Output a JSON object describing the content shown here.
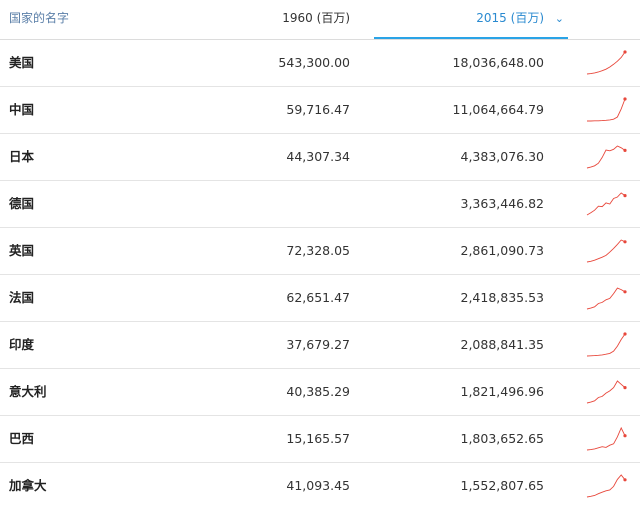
{
  "header": {
    "name_label": "国家的名字",
    "col_1960_label": "1960 (百万)",
    "col_2015_label": "2015 (百万)",
    "sort_icon": "chevron-down-icon",
    "active_color": "#2aa3e6",
    "spark_color": "#e8483c"
  },
  "rows": [
    {
      "name": "美国",
      "v1960": "543,300.00",
      "v2015": "18,036,648.00",
      "spark": [
        0.0,
        0.02,
        0.05,
        0.09,
        0.15,
        0.22,
        0.32,
        0.44,
        0.58,
        0.75,
        1.0
      ]
    },
    {
      "name": "中国",
      "v1960": "59,716.47",
      "v2015": "11,064,664.79",
      "spark": [
        0.0,
        0.0,
        0.01,
        0.01,
        0.02,
        0.03,
        0.05,
        0.08,
        0.18,
        0.55,
        1.0
      ]
    },
    {
      "name": "日本",
      "v1960": "44,307.34",
      "v2015": "4,383,076.30",
      "spark": [
        0.0,
        0.04,
        0.1,
        0.22,
        0.48,
        0.82,
        0.78,
        0.85,
        1.0,
        0.92,
        0.8
      ]
    },
    {
      "name": "德国",
      "v1960": "",
      "v2015": "3,363,446.82",
      "spark": [
        0.0,
        0.1,
        0.22,
        0.4,
        0.38,
        0.55,
        0.5,
        0.75,
        0.82,
        1.0,
        0.88
      ]
    },
    {
      "name": "英国",
      "v1960": "72,328.05",
      "v2015": "2,861,090.73",
      "spark": [
        0.0,
        0.03,
        0.08,
        0.15,
        0.22,
        0.3,
        0.45,
        0.62,
        0.8,
        1.0,
        0.92
      ]
    },
    {
      "name": "法国",
      "v1960": "62,651.47",
      "v2015": "2,418,835.53",
      "spark": [
        0.0,
        0.04,
        0.1,
        0.25,
        0.3,
        0.42,
        0.48,
        0.7,
        0.95,
        0.88,
        0.78
      ]
    },
    {
      "name": "印度",
      "v1960": "37,679.27",
      "v2015": "2,088,841.35",
      "spark": [
        0.0,
        0.01,
        0.02,
        0.03,
        0.05,
        0.08,
        0.12,
        0.22,
        0.45,
        0.75,
        1.0
      ]
    },
    {
      "name": "意大利",
      "v1960": "40,385.29",
      "v2015": "1,821,496.96",
      "spark": [
        0.0,
        0.04,
        0.1,
        0.25,
        0.3,
        0.45,
        0.55,
        0.7,
        1.0,
        0.85,
        0.7
      ]
    },
    {
      "name": "巴西",
      "v1960": "15,165.57",
      "v2015": "1,803,652.65",
      "spark": [
        0.0,
        0.02,
        0.05,
        0.1,
        0.15,
        0.12,
        0.22,
        0.28,
        0.6,
        1.0,
        0.65
      ]
    },
    {
      "name": "加拿大",
      "v1960": "41,093.45",
      "v2015": "1,552,807.65",
      "spark": [
        0.0,
        0.03,
        0.07,
        0.15,
        0.22,
        0.28,
        0.32,
        0.48,
        0.8,
        1.0,
        0.78
      ]
    }
  ]
}
